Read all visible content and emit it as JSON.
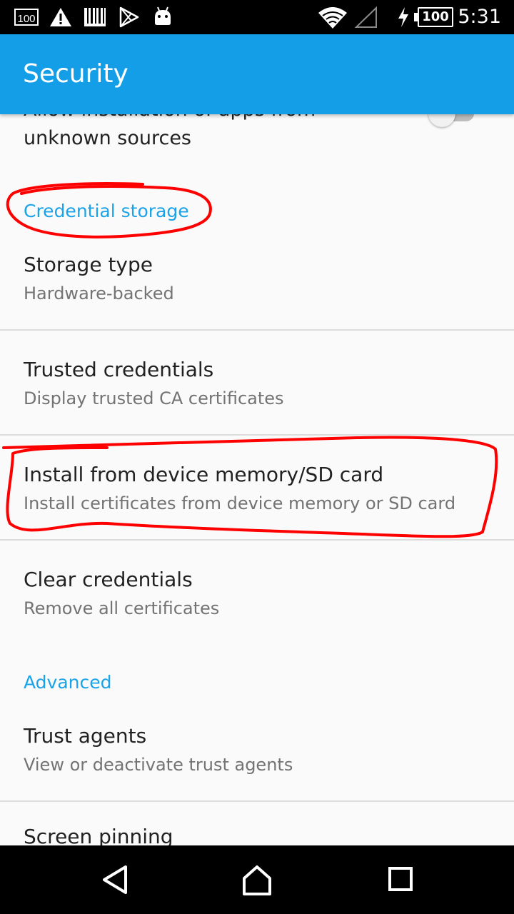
{
  "status_bar": {
    "icons": [
      "100-notification-icon",
      "warning-icon",
      "barcode-icon",
      "play-store-icon",
      "android-icon",
      "wifi-icon",
      "cell-signal-icon",
      "charging-icon"
    ],
    "battery_level": "100",
    "time": "5:31"
  },
  "app_bar": {
    "title": "Security",
    "color": "#149ee8"
  },
  "partial_item": {
    "title": "Allow installation of apps from unknown sources",
    "toggle_on": false
  },
  "sections": {
    "credential_storage": "Credential storage",
    "advanced": "Advanced"
  },
  "items": [
    {
      "primary": "Storage type",
      "secondary": "Hardware-backed"
    },
    {
      "primary": "Trusted credentials",
      "secondary": "Display trusted CA certificates"
    },
    {
      "primary": "Install from device memory/SD card",
      "secondary": "Install certificates from device memory or SD card"
    },
    {
      "primary": "Clear credentials",
      "secondary": "Remove all certificates"
    },
    {
      "primary": "Trust agents",
      "secondary": "View or deactivate trust agents"
    },
    {
      "primary": "Screen pinning",
      "secondary": ""
    }
  ],
  "accent_color": "#1aa3e8",
  "annotation_color": "#ff0000",
  "nav_bar": {
    "icons": [
      "back-icon",
      "home-icon",
      "recents-icon"
    ]
  }
}
